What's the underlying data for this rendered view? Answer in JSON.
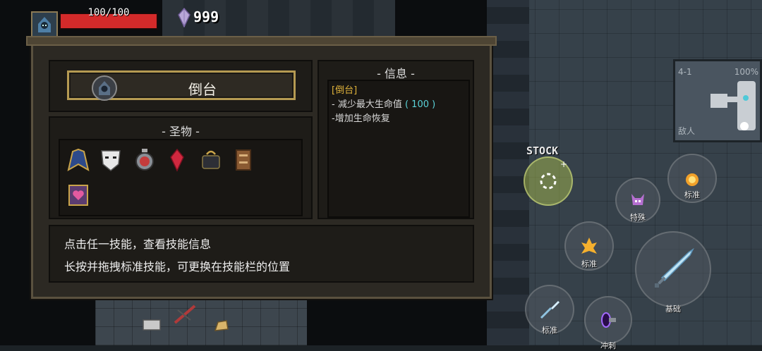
{
  "hud": {
    "hp_text": "100/100",
    "hp_fraction": 1.0,
    "gem_count": "999"
  },
  "panel": {
    "character": {
      "name": "倒台"
    },
    "relics": {
      "title": "- 圣物 -",
      "items": [
        {
          "icon": "blue-cloak-icon"
        },
        {
          "icon": "white-mask-icon"
        },
        {
          "icon": "stopwatch-icon"
        },
        {
          "icon": "red-crystal-icon"
        },
        {
          "icon": "dark-bag-icon"
        },
        {
          "icon": "wooden-box-icon"
        },
        {
          "icon": "heart-book-icon"
        }
      ]
    },
    "info": {
      "title": "- 信息 -",
      "name_line": "[倒台]",
      "line1_prefix": "- 减少最大生命值",
      "line1_value": "( 100 )",
      "line2": "-增加生命恢复"
    },
    "tips": {
      "line1": "点击任一技能，查看技能信息",
      "line2": "长按并拖拽标准技能，可更换在技能栏的位置"
    }
  },
  "minimap": {
    "level": "4-1",
    "percent": "100%",
    "enemy_label": "敌人"
  },
  "skills": {
    "stock_label": "STOCK",
    "standard_label": "标准",
    "special_label": "特殊",
    "basic_label": "基础",
    "dash_label": "冲刺"
  },
  "colors": {
    "accent_gold": "#b59a52",
    "hp_red": "#d42a2a",
    "info_cyan": "#5ad2d8",
    "info_name_yellow": "#e0b33b"
  }
}
